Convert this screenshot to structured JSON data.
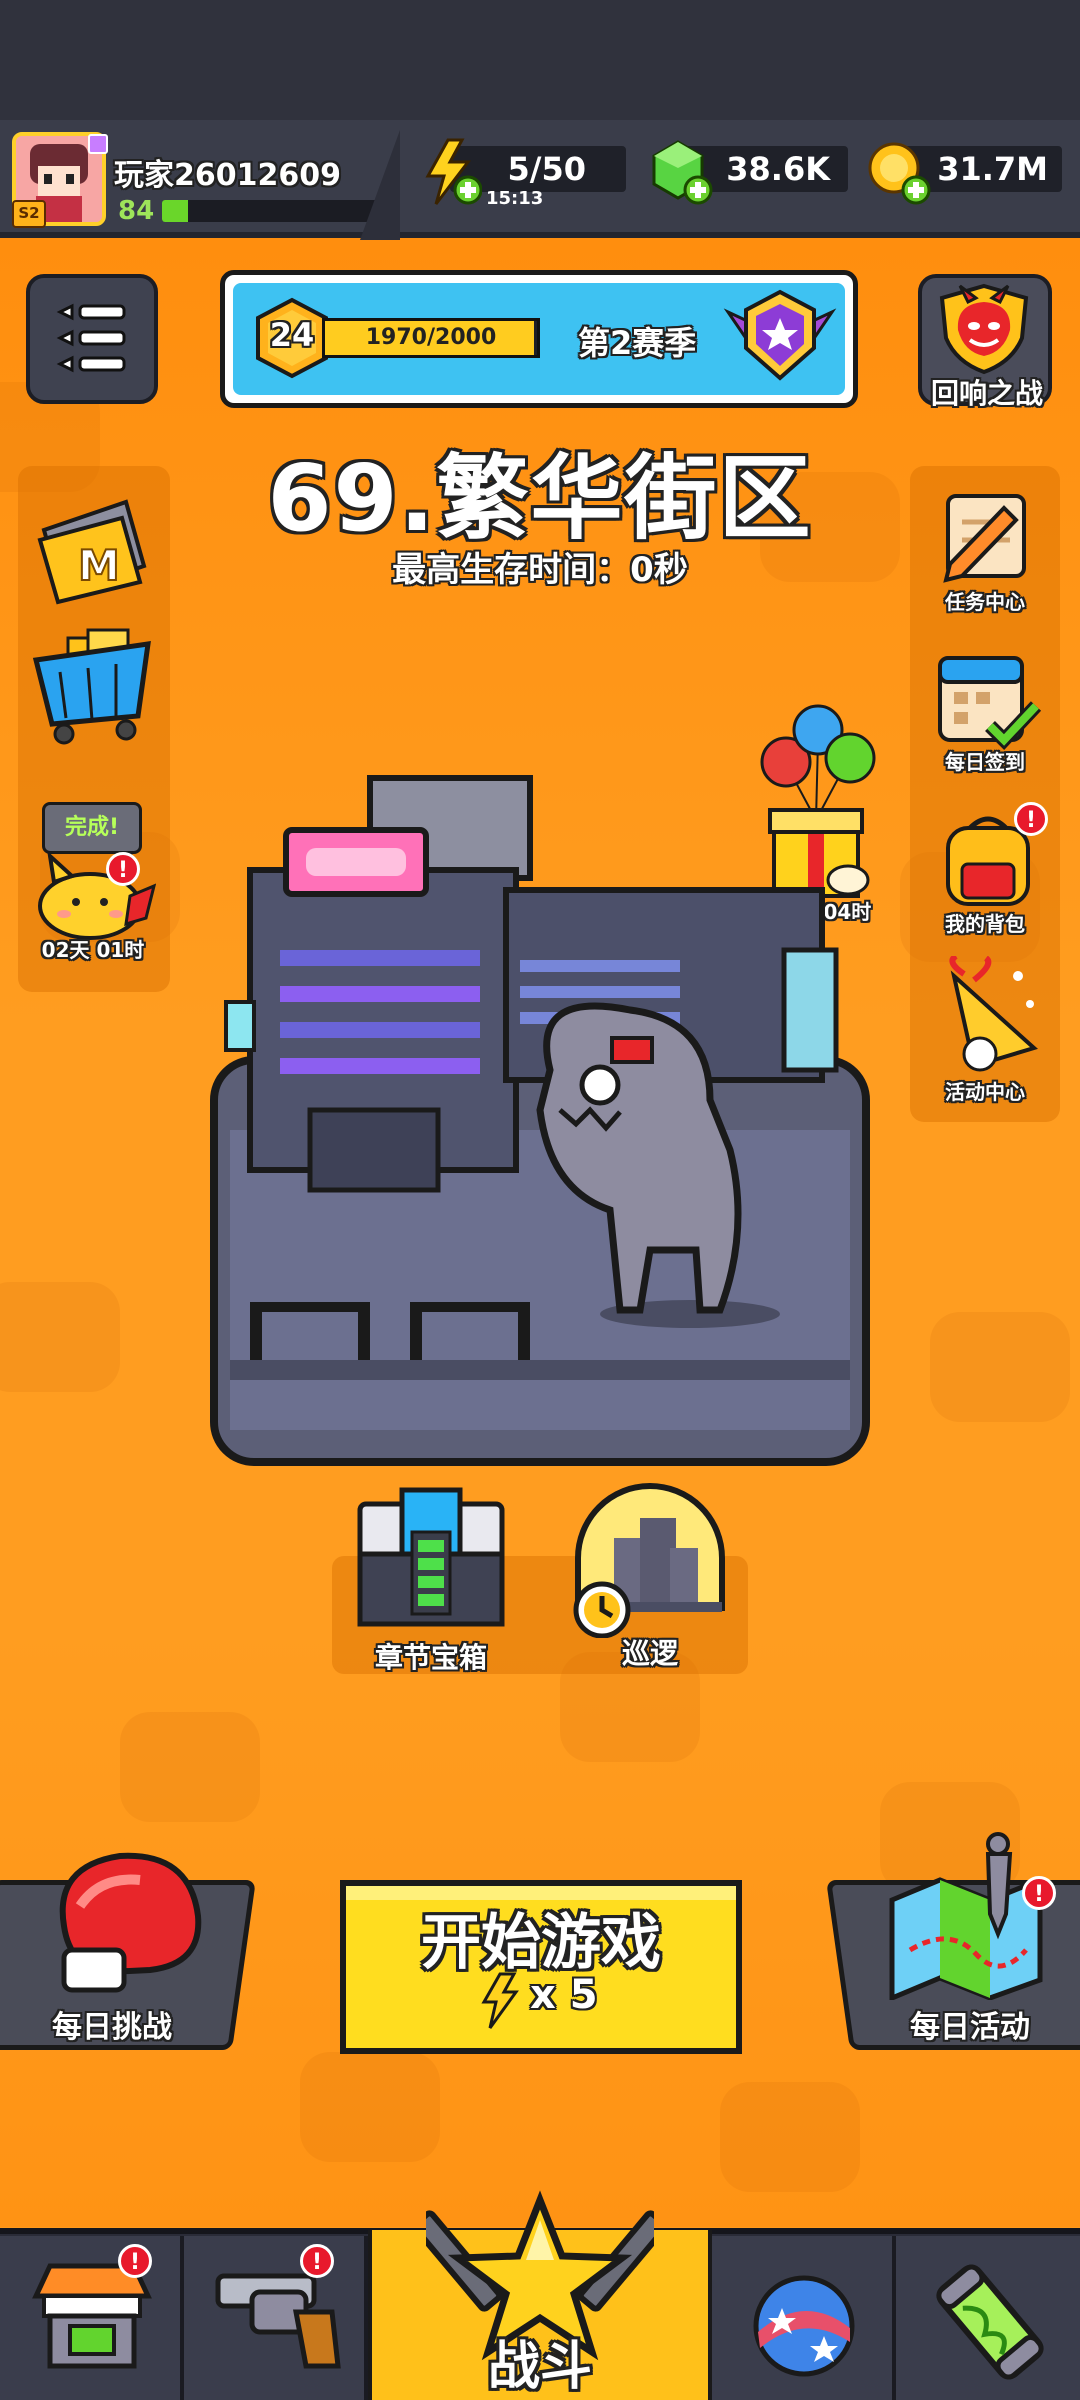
{
  "player": {
    "name": "玩家26012609",
    "level": "84",
    "badge": "S2",
    "xp_fraction": 0.12
  },
  "resources": {
    "energy": {
      "value": "5/50",
      "timer": "15:13"
    },
    "gems": {
      "value": "38.6K"
    },
    "gold": {
      "value": "31.7M"
    }
  },
  "season": {
    "level": "24",
    "progress_text": "1970/2000",
    "progress_fraction": 0.985,
    "label": "第2赛季"
  },
  "top_right": {
    "label": "回响之战"
  },
  "stage": {
    "title": "69.繁华街区",
    "best_time": "最高生存时间：0秒"
  },
  "left_side": {
    "pet_status": "完成!",
    "pet_timer": "02天 01时"
  },
  "right_side": {
    "gift_timer": "04天 04时",
    "items": [
      "任务中心",
      "每日签到",
      "我的背包",
      "活动中心"
    ]
  },
  "below_stage": {
    "chest_label": "章节宝箱",
    "patrol_label": "巡逻"
  },
  "actions": {
    "daily_challenge": "每日挑战",
    "start_game": "开始游戏",
    "energy_cost": "x 5",
    "daily_event": "每日活动"
  },
  "bottom_nav": {
    "battle_label": "战斗",
    "alert": "!"
  },
  "colors": {
    "orange": "#ff9d20",
    "yellow_button": "#ffdd1f",
    "accent_blue": "#3fc0f0",
    "dark_panel": "#3a3d4a"
  }
}
